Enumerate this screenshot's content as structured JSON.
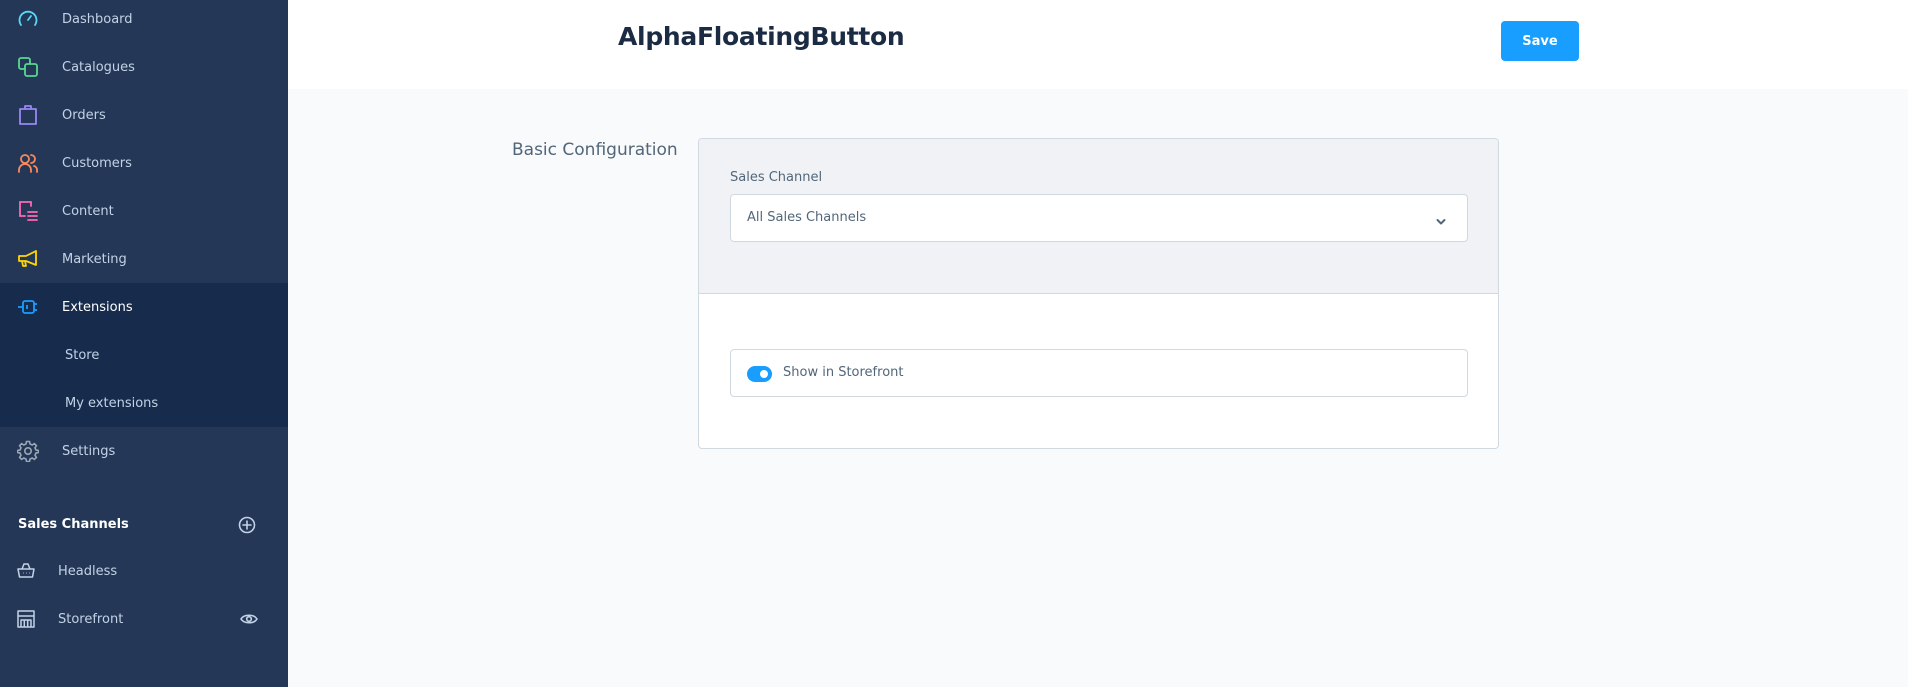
{
  "sidebar": {
    "items": [
      {
        "label": "Dashboard",
        "icon": "dashboard-gauge-icon",
        "color": "#57d9f5"
      },
      {
        "label": "Catalogues",
        "icon": "catalogues-icon",
        "color": "#57d98f"
      },
      {
        "label": "Orders",
        "icon": "orders-bag-icon",
        "color": "#9987f5"
      },
      {
        "label": "Customers",
        "icon": "customers-icon",
        "color": "#fa8a5c"
      },
      {
        "label": "Content",
        "icon": "content-icon",
        "color": "#ff68b4"
      },
      {
        "label": "Marketing",
        "icon": "marketing-megaphone-icon",
        "color": "#ffd700"
      },
      {
        "label": "Extensions",
        "icon": "extensions-plug-icon",
        "color": "#189eff",
        "active": true
      },
      {
        "label": "Settings",
        "icon": "settings-gear-icon",
        "color": "#9aa8b5"
      }
    ],
    "sub_items": [
      {
        "label": "Store"
      },
      {
        "label": "My extensions"
      }
    ],
    "sales_channels": {
      "title": "Sales Channels",
      "items": [
        {
          "label": "Headless",
          "icon": "basket-icon"
        },
        {
          "label": "Storefront",
          "icon": "storefront-icon",
          "action_icon": "eye-icon"
        }
      ]
    }
  },
  "header": {
    "title": "AlphaFloatingButton",
    "save_label": "Save",
    "accent": "#189eff"
  },
  "main": {
    "section_label": "Basic Configuration",
    "sales_channel": {
      "label": "Sales Channel",
      "value": "All Sales Channels"
    },
    "show_in_storefront": {
      "label": "Show in Storefront",
      "checked": true
    }
  }
}
